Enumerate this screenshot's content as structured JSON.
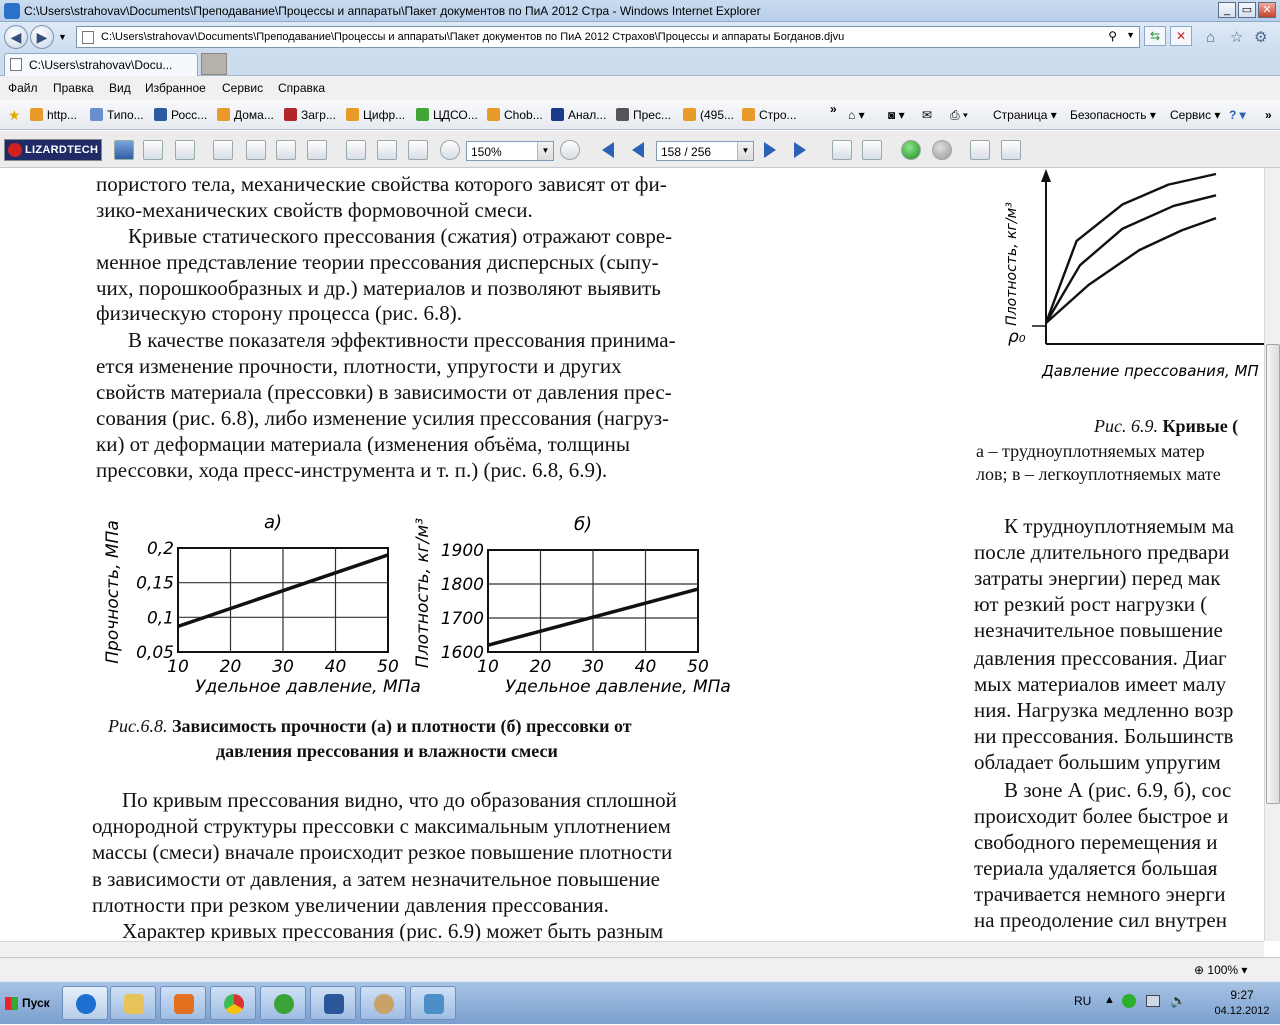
{
  "window": {
    "title": "C:\\Users\\strahovav\\Documents\\Преподавание\\Процессы и аппараты\\Пакет документов по ПиА 2012 Стра - Windows Internet Explorer"
  },
  "address": {
    "url": "C:\\Users\\strahovav\\Documents\\Преподавание\\Процессы и аппараты\\Пакет документов по ПиА 2012 Страхов\\Процессы и аппараты Богданов.djvu"
  },
  "tab": {
    "label": "C:\\Users\\strahovav\\Docu..."
  },
  "menu": [
    "Файл",
    "Правка",
    "Вид",
    "Избранное",
    "Сервис",
    "Справка"
  ],
  "favorites": [
    "http...",
    "Типо...",
    "Росс...",
    "Дома...",
    "Загр...",
    "Цифр...",
    "ЦДСО...",
    "Chob...",
    "Анал...",
    "Прес...",
    "(495...",
    "Стро..."
  ],
  "commandbar": {
    "page": "Страница",
    "safety": "Безопасность",
    "tools": "Сервис"
  },
  "djvu": {
    "logo": "LIZARDTECH",
    "zoom": "150%",
    "page": "158 / 256"
  },
  "document": {
    "left_top": [
      "пористого тела, механические свойства которого зависят от фи-",
      "зико-механических свойств формовочной смеси.",
      "Кривые статического прессования (сжатия) отражают совре-",
      "менное представление теории прессования дисперсных (сыпу-",
      "чих, порошкообразных и др.) материалов и позволяют выявить",
      "физическую сторону процесса (рис. 6.8).",
      "В качестве показателя эффективности прессования принима-",
      "ется изменение прочности, плотности, упругости и других",
      "свойств материала (прессовки) в зависимости от давления прес-",
      "сования (рис. 6.8), либо изменение усилия прессования (нагруз-",
      "ки) от деформации материала (изменения объёма, толщины",
      "прессовки, хода пресс-инструмента и т. п.) (рис. 6.8, 6.9)."
    ],
    "fig68_caption_lead": "Рис.6.8.",
    "fig68_caption_rest": " Зависимость прочности (а) и плотности (б) прессовки от",
    "fig68_caption_line2": "давления прессования и влажности смеси",
    "left_bottom": [
      "По кривым прессования видно, что до образования сплошной",
      "однородной структуры прессовки с максимальным уплотнением",
      "массы (смеси) вначале происходит резкое повышение плотности",
      "в зависимости от давления, а затем незначительное повышение",
      "плотности при резком увеличении давления прессования.",
      "Характер кривых прессования (рис. 6.9) может быть разным"
    ],
    "fig69_caption_lead": "Рис. 6.9.",
    "fig69_caption_bold": " Кривые (",
    "fig69_line2": "а – трудноуплотняемых матер",
    "fig69_line3": "лов; в – легкоуплотняемых мате",
    "right_col": [
      "К трудноуплотняемым ма",
      "после длительного предвари",
      "затраты энергии) перед мак",
      "ют резкий рост нагрузки (",
      "незначительное повышение",
      "давления прессования. Диаг",
      "мых материалов имеет малу",
      "ния. Нагрузка медленно возр",
      "ни прессования. Большинств",
      "обладает большим упругим",
      "В зоне А (рис. 6.9, б), сос",
      "происходит более быстрое и",
      "свободного перемещения и",
      "териала удаляется большая",
      "трачивается немного энерги",
      "на преодоление сил внутрен"
    ]
  },
  "chart_data": [
    {
      "type": "line",
      "title": "а)",
      "xlabel": "Удельное давление, МПа",
      "ylabel": "Прочность, МПа",
      "x_ticks": [
        "10",
        "20",
        "30",
        "40",
        "50"
      ],
      "y_ticks": [
        "0,05",
        "0,1",
        "0,15",
        "0,2"
      ],
      "xlim": [
        10,
        50
      ],
      "ylim": [
        0.05,
        0.2
      ],
      "grid": true,
      "series": [
        {
          "x": [
            10,
            50
          ],
          "y": [
            0.087,
            0.19
          ]
        }
      ]
    },
    {
      "type": "line",
      "title": "б)",
      "xlabel": "Удельное давление, МПа",
      "ylabel": "Плотность, кг/м³",
      "x_ticks": [
        "10",
        "20",
        "30",
        "40",
        "50"
      ],
      "y_ticks": [
        "1600",
        "1700",
        "1800",
        "1900"
      ],
      "xlim": [
        10,
        50
      ],
      "ylim": [
        1600,
        1900
      ],
      "grid": true,
      "series": [
        {
          "x": [
            10,
            50
          ],
          "y": [
            1620,
            1785
          ]
        }
      ]
    },
    {
      "type": "line",
      "xlabel": "Давление прессования, МП",
      "ylabel": "Плотность, кг/м³",
      "y_marker": "ρ₀",
      "grid": false,
      "series": [
        {
          "x": [
            0,
            0.18,
            0.45,
            0.72,
            1.0
          ],
          "y": [
            0.02,
            0.56,
            0.8,
            0.93,
            1.0
          ]
        },
        {
          "x": [
            0,
            0.2,
            0.45,
            0.75,
            1.0
          ],
          "y": [
            0.02,
            0.4,
            0.64,
            0.79,
            0.86
          ]
        },
        {
          "x": [
            0,
            0.25,
            0.55,
            0.8,
            1.0
          ],
          "y": [
            0.02,
            0.27,
            0.5,
            0.63,
            0.71
          ]
        }
      ]
    }
  ],
  "status": {
    "zoom": "100%"
  },
  "taskbar": {
    "start": "Пуск",
    "lang": "RU",
    "time": "9:27",
    "date": "04.12.2012"
  }
}
